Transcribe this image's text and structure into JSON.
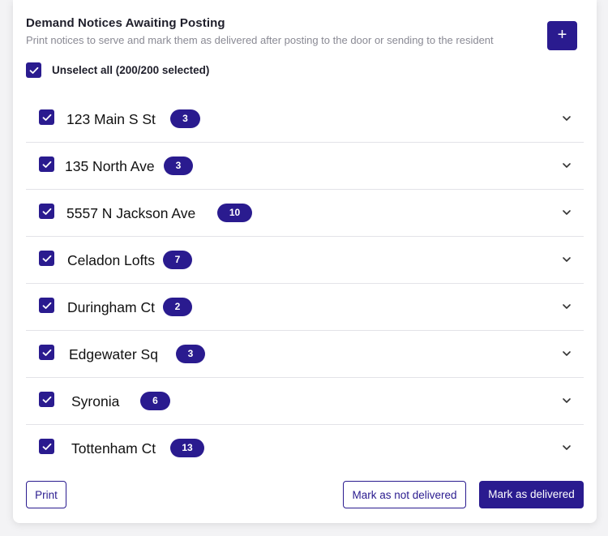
{
  "header": {
    "title": "Demand Notices Awaiting Posting",
    "subtitle": "Print notices to serve and mark them as delivered after posting to the door or sending to the resident",
    "add_label": "+"
  },
  "select_all": {
    "label": "Unselect all (200/200 selected)",
    "checked": true
  },
  "properties": [
    {
      "name": "123 Main S St",
      "count": "3",
      "checked": true
    },
    {
      "name": "135 North Ave",
      "count": "3",
      "checked": true
    },
    {
      "name": "5557 N Jackson Ave",
      "count": "10",
      "checked": true
    },
    {
      "name": "Celadon Lofts",
      "count": "7",
      "checked": true
    },
    {
      "name": "Duringham Ct",
      "count": "2",
      "checked": true
    },
    {
      "name": "Edgewater Sq",
      "count": "3",
      "checked": true
    },
    {
      "name": "Syronia",
      "count": "6",
      "checked": true
    },
    {
      "name": "Tottenham Ct",
      "count": "13",
      "checked": true
    }
  ],
  "footer": {
    "print_label": "Print",
    "mark_not_delivered_label": "Mark as not delivered",
    "mark_delivered_label": "Mark as delivered"
  },
  "colors": {
    "accent": "#2a1b8f",
    "divider": "#e3e3e8",
    "subtitle": "#8a8a94"
  },
  "icons": {
    "checkbox": "check-icon",
    "expand": "chevron-down-icon",
    "add": "plus-icon"
  }
}
